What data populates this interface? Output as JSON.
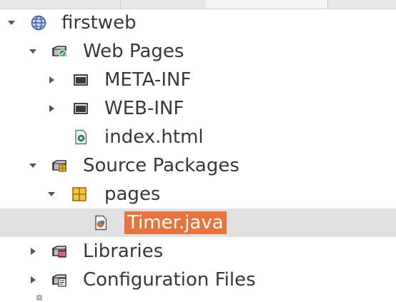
{
  "tree": {
    "items": [
      {
        "label": "firstweb",
        "icon": "globe-icon",
        "expanded": true
      },
      {
        "label": "Web Pages",
        "icon": "web-pages-folder-icon",
        "expanded": true
      },
      {
        "label": "META-INF",
        "icon": "folder-icon",
        "expanded": false
      },
      {
        "label": "WEB-INF",
        "icon": "folder-icon",
        "expanded": false
      },
      {
        "label": "index.html",
        "icon": "html-file-icon"
      },
      {
        "label": "Source Packages",
        "icon": "source-packages-icon",
        "expanded": true
      },
      {
        "label": "pages",
        "icon": "package-icon",
        "expanded": true
      },
      {
        "label": "Timer.java",
        "icon": "java-file-icon",
        "selected": true
      },
      {
        "label": "Libraries",
        "icon": "libraries-icon",
        "expanded": false
      },
      {
        "label": "Configuration Files",
        "icon": "configuration-files-icon",
        "expanded": false
      }
    ]
  },
  "colors": {
    "selection_row": "#e1e1e1",
    "selection_label": "#e8733b",
    "text": "#383838"
  }
}
